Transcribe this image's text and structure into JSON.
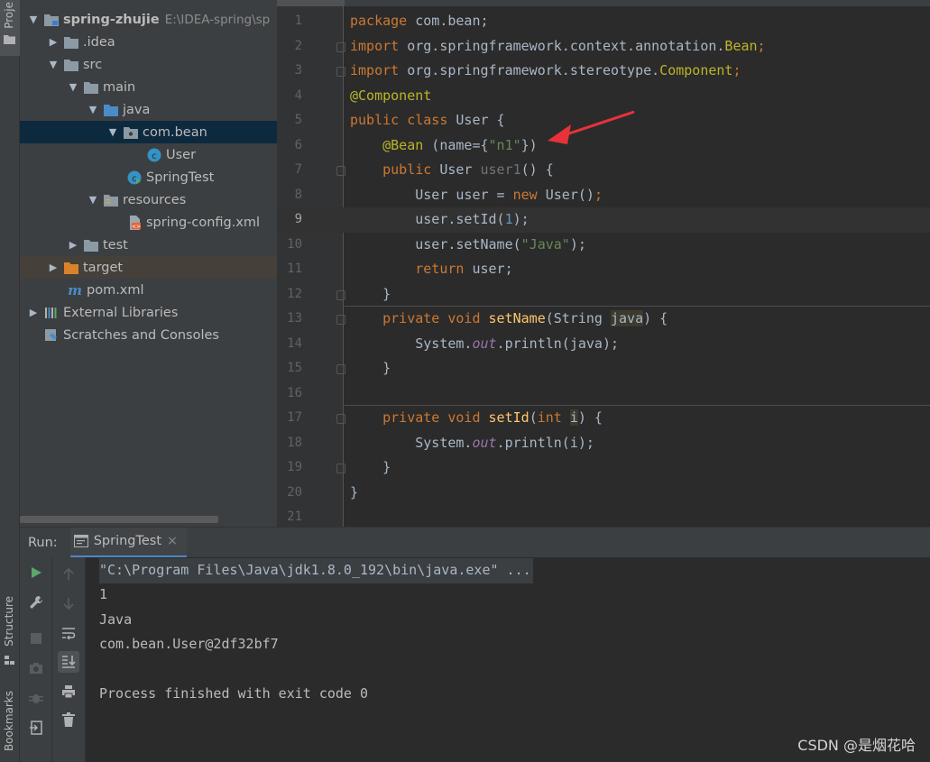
{
  "left_strip": {
    "project_tab": "Proje",
    "structure_tab": "Structure",
    "bookmarks_tab": "Bookmarks"
  },
  "project_tree": {
    "root_name": "spring-zhujie",
    "root_path": "E:\\IDEA-spring\\sp",
    "items": [
      {
        "label": ".idea"
      },
      {
        "label": "src"
      },
      {
        "label": "main"
      },
      {
        "label": "java"
      },
      {
        "label": "com.bean"
      },
      {
        "label": "User"
      },
      {
        "label": "SpringTest"
      },
      {
        "label": "resources"
      },
      {
        "label": "spring-config.xml"
      },
      {
        "label": "test"
      },
      {
        "label": "target"
      },
      {
        "label": "pom.xml"
      },
      {
        "label": "External Libraries"
      },
      {
        "label": "Scratches and Consoles"
      }
    ]
  },
  "editor": {
    "current_line": 9,
    "line_numbers": [
      "1",
      "2",
      "3",
      "4",
      "5",
      "6",
      "7",
      "8",
      "9",
      "10",
      "11",
      "12",
      "13",
      "14",
      "15",
      "16",
      "17",
      "18",
      "19",
      "20",
      "21"
    ],
    "tokens": {
      "l1_kw": "package",
      "l1_rest": " com.bean;",
      "l2_kw": "import",
      "l2_rest": " org.springframework.context.annotation.",
      "l2_cls": "Bean",
      "l2_end": ";",
      "l3_kw": "import",
      "l3_rest": " org.springframework.stereotype.",
      "l3_cls": "Component",
      "l3_end": ";",
      "l4_ann": "@Component",
      "l5_kw": "public class",
      "l5_rest": " User {",
      "l6_indent": "    ",
      "l6_ann": "@Bean",
      "l6_mid": " (name={",
      "l6_str": "\"n1\"",
      "l6_end": "})",
      "l7_indent": "    ",
      "l7_kw": "public",
      "l7_type": " User ",
      "l7_fn": "user1",
      "l7_end": "() {",
      "l8_indent": "        ",
      "l8_a": "User user = ",
      "l8_kw": "new",
      "l8_b": " User()",
      "l8_end": ";",
      "l9_indent": "        ",
      "l9_a": "user.setId(",
      "l9_num": "1",
      "l9_end": ");",
      "l10_indent": "        ",
      "l10_a": "user.setName(",
      "l10_str": "\"Java\"",
      "l10_end": ");",
      "l11_indent": "        ",
      "l11_kw": "return",
      "l11_rest": " user;",
      "l12_text": "    }",
      "l13_indent": "    ",
      "l13_kw": "private void",
      "l13_sp": " ",
      "l13_fn": "setName",
      "l13_mid": "(String ",
      "l13_param": "java",
      "l13_end": ") {",
      "l14_indent": "        ",
      "l14_a": "System.",
      "l14_field": "out",
      "l14_b": ".println(java);",
      "l15_text": "    }",
      "l17_indent": "    ",
      "l17_kw": "private void",
      "l17_sp": " ",
      "l17_fn": "setId",
      "l17_mid": "(",
      "l17_kw2": "int",
      "l17_sp2": " ",
      "l17_param": "i",
      "l17_end": ") {",
      "l18_indent": "        ",
      "l18_a": "System.",
      "l18_field": "out",
      "l18_b": ".println(i);",
      "l19_text": "    }",
      "l20_text": "}"
    }
  },
  "run_panel": {
    "run_label": "Run:",
    "tab_label": "SpringTest",
    "tab_close": "×",
    "console_lines": [
      "\"C:\\Program Files\\Java\\jdk1.8.0_192\\bin\\java.exe\" ...",
      "1",
      "Java",
      "com.bean.User@2df32bf7",
      "",
      "Process finished with exit code 0"
    ]
  },
  "watermark": "CSDN @是烟花哈",
  "colors": {
    "keyword": "#cc7832",
    "annotation": "#bbb529",
    "string": "#6a8759",
    "number": "#6897bb",
    "method": "#ffc66d",
    "field": "#9876aa",
    "arrow_red": "#e8323a"
  }
}
